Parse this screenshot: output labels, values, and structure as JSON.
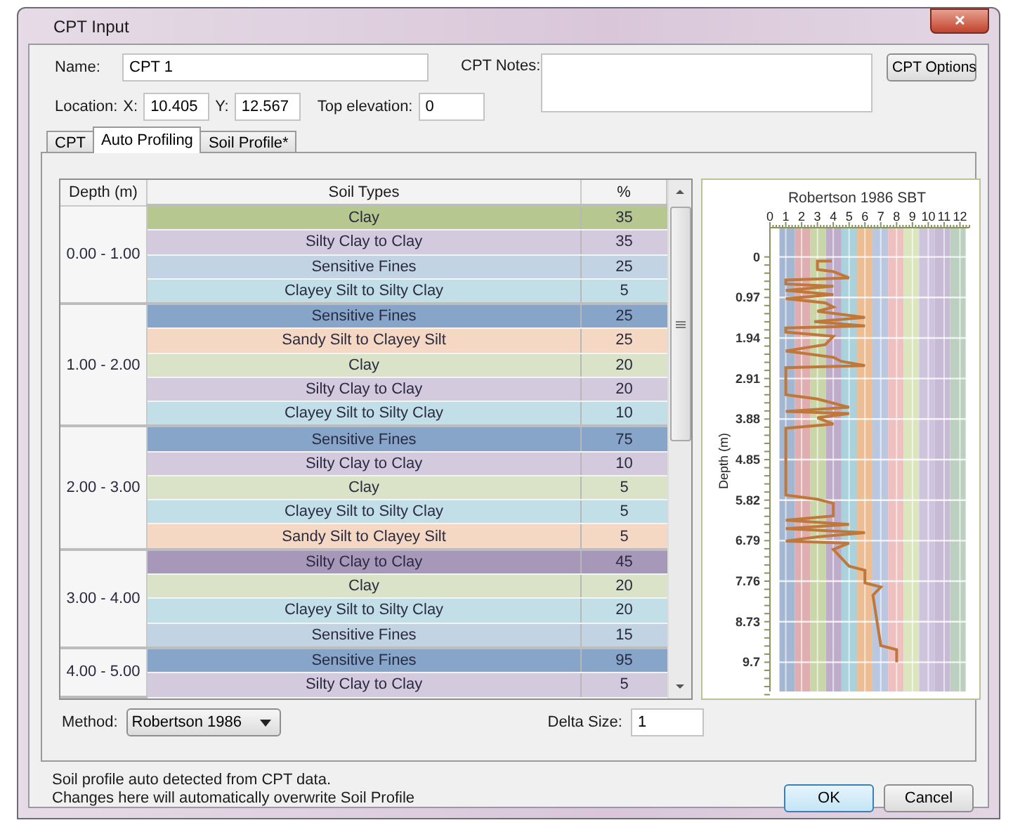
{
  "window": {
    "title": "CPT Input",
    "close": "✕"
  },
  "form": {
    "name_label": "Name:",
    "name_value": "CPT 1",
    "notes_label": "CPT Notes:",
    "options_button": "CPT Options",
    "location_label": "Location:",
    "x_label": "X:",
    "x_value": "10.405",
    "y_label": "Y:",
    "y_value": "12.567",
    "elevation_label": "Top elevation:",
    "elevation_value": "0"
  },
  "tabs": [
    {
      "label": "CPT",
      "selected": false
    },
    {
      "label": "Auto Profiling",
      "selected": true
    },
    {
      "label": "Soil Profile*",
      "selected": false
    }
  ],
  "table": {
    "columns": [
      "Depth (m)",
      "Soil Types",
      "%"
    ],
    "groups": [
      {
        "depth": "0.00 - 1.00",
        "rows": [
          {
            "soil": "Clay",
            "percent": "35",
            "color": "#b6c790"
          },
          {
            "soil": "Silty Clay to Clay",
            "percent": "35",
            "color": "#d4cade"
          },
          {
            "soil": "Sensitive Fines",
            "percent": "25",
            "color": "#c2d3e3"
          },
          {
            "soil": "Clayey Silt to Silty Clay",
            "percent": "5",
            "color": "#c2dfe7"
          }
        ]
      },
      {
        "depth": "1.00 - 2.00",
        "rows": [
          {
            "soil": "Sensitive Fines",
            "percent": "25",
            "color": "#86a5c8"
          },
          {
            "soil": "Sandy Silt to Clayey Silt",
            "percent": "25",
            "color": "#f4d8c4"
          },
          {
            "soil": "Clay",
            "percent": "20",
            "color": "#dae3c8"
          },
          {
            "soil": "Silty Clay to Clay",
            "percent": "20",
            "color": "#d4cade"
          },
          {
            "soil": "Clayey Silt to Silty Clay",
            "percent": "10",
            "color": "#c2dfe7"
          }
        ]
      },
      {
        "depth": "2.00 - 3.00",
        "rows": [
          {
            "soil": "Sensitive Fines",
            "percent": "75",
            "color": "#86a5c8"
          },
          {
            "soil": "Silty Clay to Clay",
            "percent": "10",
            "color": "#d4cade"
          },
          {
            "soil": "Clay",
            "percent": "5",
            "color": "#dae3c8"
          },
          {
            "soil": "Clayey Silt to Silty Clay",
            "percent": "5",
            "color": "#c2dfe7"
          },
          {
            "soil": "Sandy Silt to Clayey Silt",
            "percent": "5",
            "color": "#f4d8c4"
          }
        ]
      },
      {
        "depth": "3.00 - 4.00",
        "rows": [
          {
            "soil": "Silty Clay to Clay",
            "percent": "45",
            "color": "#a797b9"
          },
          {
            "soil": "Clay",
            "percent": "20",
            "color": "#dae3c8"
          },
          {
            "soil": "Clayey Silt to Silty Clay",
            "percent": "20",
            "color": "#c2dfe7"
          },
          {
            "soil": "Sensitive Fines",
            "percent": "15",
            "color": "#c2d3e3"
          }
        ]
      },
      {
        "depth": "4.00 - 5.00",
        "rows": [
          {
            "soil": "Sensitive Fines",
            "percent": "95",
            "color": "#86a5c8"
          },
          {
            "soil": "Silty Clay to Clay",
            "percent": "5",
            "color": "#d4cade"
          }
        ]
      }
    ]
  },
  "chart": {
    "chart_data": {
      "type": "line",
      "title": "Robertson 1986 SBT",
      "ylabel": "Depth (m)",
      "x": [
        3.9,
        3.0,
        3.0,
        4.0,
        5.0,
        1.0,
        1.0,
        4.0,
        1.0,
        4.0,
        1.0,
        3.5,
        4.0,
        3.0,
        6.0,
        2.8,
        6.0,
        1.0,
        1.0,
        4.0,
        3.5,
        1.0,
        4.0,
        4.5,
        6.0,
        1.0,
        1.0,
        3.0,
        4.0,
        5.0,
        1.0,
        5.0,
        3.0,
        4.0,
        1.0,
        1.0,
        3.0,
        4.0,
        4.0,
        1.0,
        5.0,
        1.0,
        6.0,
        3.0,
        1.0,
        5.0,
        4.0,
        4.5,
        5.0,
        6.0,
        6.0,
        7.0,
        6.5,
        7.0,
        8.0,
        8.0
      ],
      "series": [
        {
          "color": "#c0783a",
          "values": [
            0.1,
            0.1,
            0.3,
            0.35,
            0.5,
            0.55,
            0.65,
            0.7,
            0.8,
            0.9,
            1.0,
            1.1,
            1.2,
            1.3,
            1.45,
            1.55,
            1.65,
            1.7,
            1.8,
            1.9,
            2.1,
            2.25,
            2.4,
            2.5,
            2.6,
            2.65,
            3.3,
            3.4,
            3.5,
            3.6,
            3.7,
            3.75,
            3.85,
            4.0,
            4.1,
            5.7,
            5.8,
            5.9,
            6.2,
            6.3,
            6.4,
            6.5,
            6.6,
            6.7,
            6.8,
            6.85,
            7.0,
            7.2,
            7.4,
            7.5,
            7.8,
            7.9,
            8.1,
            9.3,
            9.4,
            9.7
          ]
        }
      ],
      "xticks": [
        0,
        1,
        2,
        3,
        4,
        5,
        6,
        7,
        8,
        9,
        10,
        11,
        12
      ],
      "yticks": [
        0,
        0.97,
        1.94,
        2.91,
        3.88,
        4.85,
        5.82,
        6.79,
        7.76,
        8.73,
        9.7
      ],
      "xlim": [
        0,
        12.6
      ],
      "ylim": [
        10.4,
        -0.7
      ],
      "grid": true,
      "bands": [
        {
          "axis": "x",
          "from": 0.6,
          "to": 1.58,
          "color": "#a3b7d3"
        },
        {
          "axis": "x",
          "from": 1.58,
          "to": 2.56,
          "color": "#dfaeb0"
        },
        {
          "axis": "x",
          "from": 2.56,
          "to": 3.54,
          "color": "#c9d6a8"
        },
        {
          "axis": "x",
          "from": 3.54,
          "to": 4.52,
          "color": "#bfaccb"
        },
        {
          "axis": "x",
          "from": 4.52,
          "to": 5.5,
          "color": "#a9d2dc"
        },
        {
          "axis": "x",
          "from": 5.5,
          "to": 6.48,
          "color": "#edbd94"
        },
        {
          "axis": "x",
          "from": 6.48,
          "to": 7.46,
          "color": "#b9c8e0"
        },
        {
          "axis": "x",
          "from": 7.46,
          "to": 8.44,
          "color": "#efc0c0"
        },
        {
          "axis": "x",
          "from": 8.44,
          "to": 9.42,
          "color": "#dbe6bf"
        },
        {
          "axis": "x",
          "from": 9.42,
          "to": 10.4,
          "color": "#cfc4dd"
        },
        {
          "axis": "x",
          "from": 10.4,
          "to": 11.38,
          "color": "#c7bad6"
        },
        {
          "axis": "x",
          "from": 11.38,
          "to": 12.36,
          "color": "#bcd0bf"
        }
      ]
    }
  },
  "method": {
    "label": "Method:",
    "value": "Robertson 1986",
    "delta_label": "Delta Size:",
    "delta_value": "1"
  },
  "footer": {
    "lines": [
      "Soil profile auto detected from CPT data.",
      "Changes here will automatically overwrite Soil Profile"
    ],
    "buttons": [
      "OK",
      "Cancel"
    ]
  }
}
